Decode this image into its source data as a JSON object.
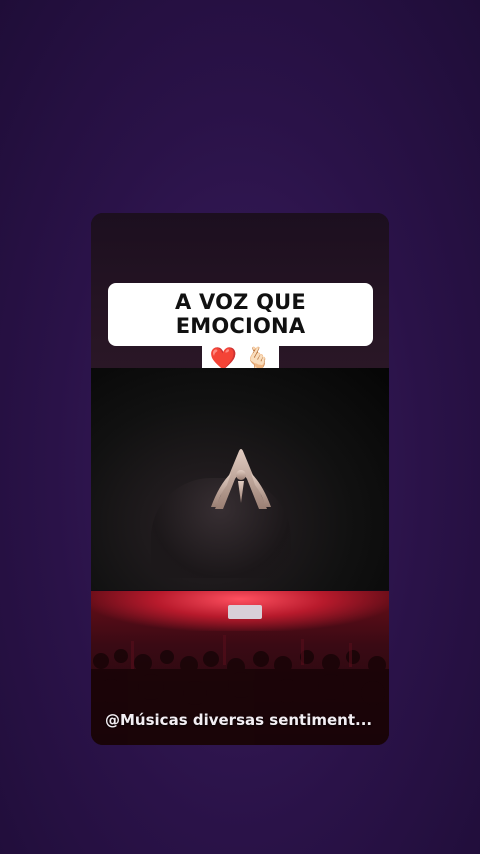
{
  "post": {
    "headline": "A VOZ QUE EMOCIONA",
    "emoji_heart": "❤️",
    "emoji_hand": "🫰🏻",
    "watermark": "@Músicas diversas sentiment..."
  },
  "colors": {
    "background": "#2a1248",
    "caption_bg": "#ffffff",
    "caption_text": "#111111",
    "heart": "#e0202a",
    "logo": "#c9b1a6",
    "concert_glow": "#b81a2c"
  },
  "icons": [
    "heart-emoji-icon",
    "finger-heart-emoji-icon",
    "artist-logo-icon"
  ]
}
